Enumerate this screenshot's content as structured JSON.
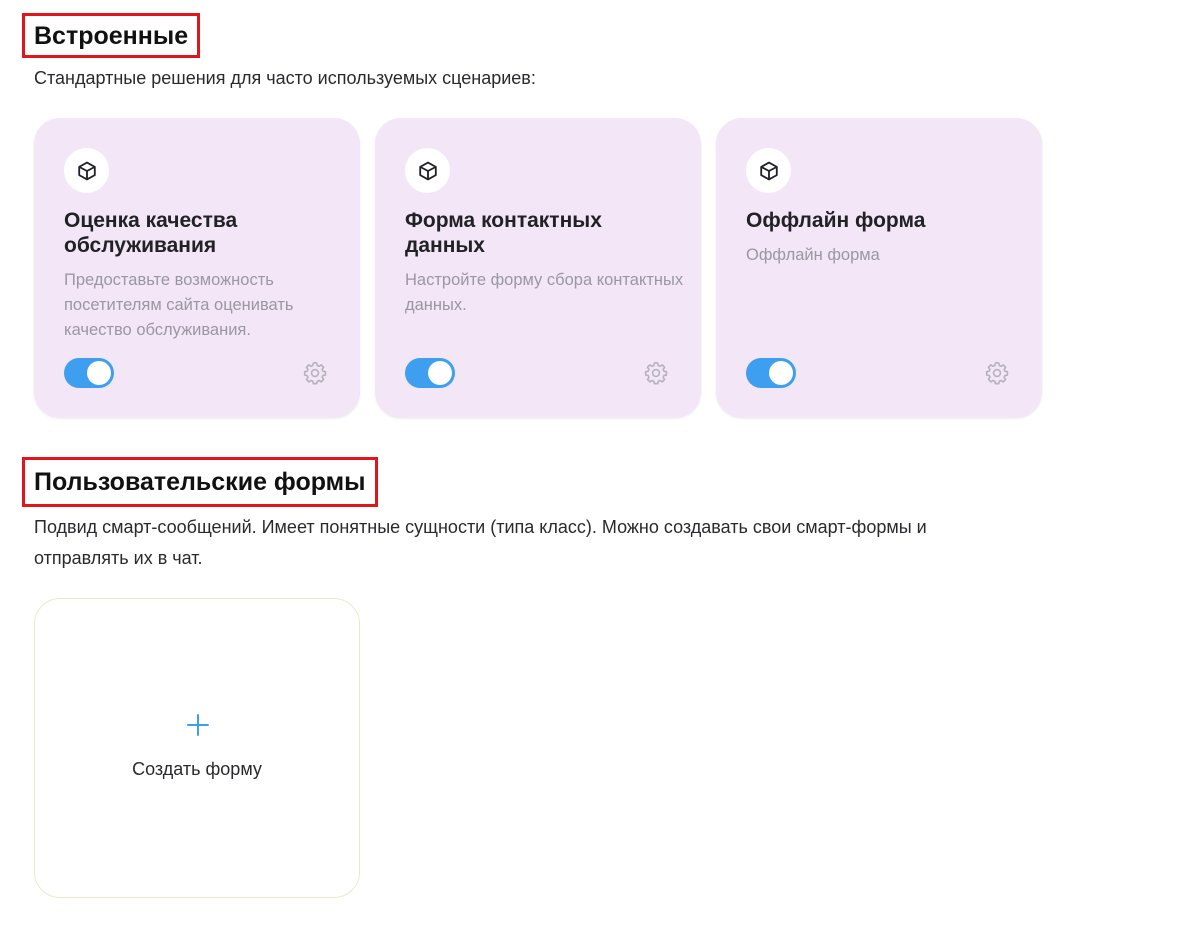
{
  "builtin": {
    "title": "Встроенные",
    "description": "Стандартные решения для часто используемых сценариев:",
    "cards": [
      {
        "title": "Оценка качества обслуживания",
        "text": "Предоставьте возможность посетителям сайта оценивать качество обслуживания.",
        "enabled": true,
        "icon": "cube-icon"
      },
      {
        "title": "Форма контактных данных",
        "text": "Настройте форму сбора контактных данных.",
        "enabled": true,
        "icon": "cube-icon"
      },
      {
        "title": "Оффлайн форма",
        "text": "Оффлайн форма",
        "enabled": true,
        "icon": "cube-icon"
      }
    ]
  },
  "custom": {
    "title": "Пользовательские формы",
    "description": "Подвид смарт-сообщений. Имеет понятные сущности (типа класс). Можно создавать свои смарт-формы и отправлять их в чат.",
    "create_label": "Создать форму",
    "create_icon": "plus-icon"
  },
  "colors": {
    "card_background": "#f3e6f6",
    "toggle_on": "#3e9ff0",
    "highlight_border": "#e0161b",
    "muted_text": "#9b97a1",
    "accent_plus": "#3e9ff0"
  }
}
